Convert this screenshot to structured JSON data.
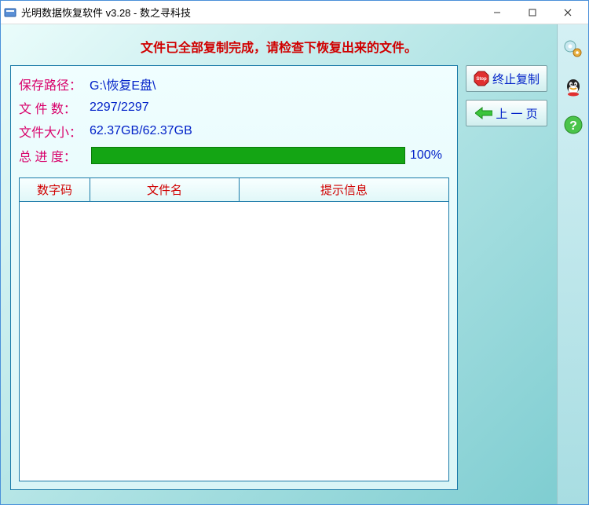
{
  "window": {
    "title": "光明数据恢复软件 v3.28 - 数之寻科技"
  },
  "status_message": "文件已全部复制完成，请检查下恢复出来的文件。",
  "info": {
    "save_path_label": "保存路径：",
    "save_path_value": "G:\\恢复E盘\\",
    "file_count_label": "文 件 数：",
    "file_count_value": "2297/2297",
    "file_size_label": "文件大小：",
    "file_size_value": "62.37GB/62.37GB",
    "progress_label": "总 进 度：",
    "progress_pct": "100%"
  },
  "table": {
    "columns": [
      "数字码",
      "文件名",
      "提示信息"
    ]
  },
  "buttons": {
    "stop_copy": "终止复制",
    "prev_page": "上 一 页"
  },
  "icons": {
    "app": "app-icon",
    "minimize": "minimize-icon",
    "maximize": "maximize-icon",
    "close": "close-icon",
    "stop": "stop-icon",
    "arrow_left": "arrow-left-icon",
    "gear": "gear-icon",
    "qq": "qq-icon",
    "help": "help-icon"
  }
}
